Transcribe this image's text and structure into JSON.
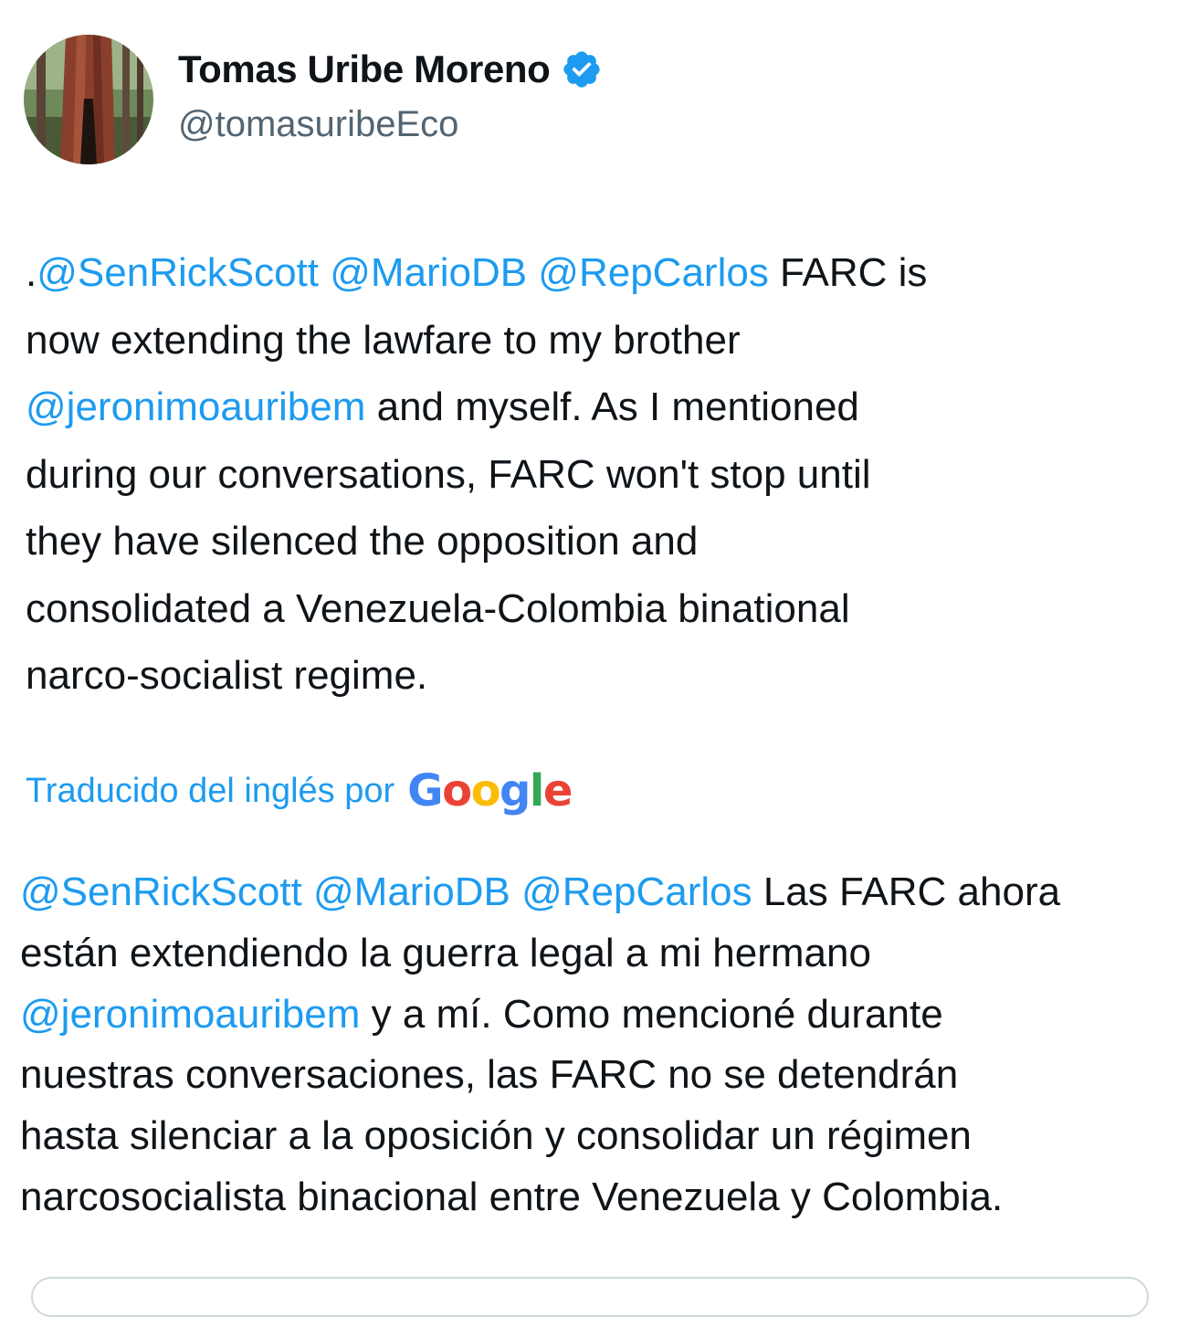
{
  "author": {
    "name": "Tomas Uribe Moreno",
    "handle": "@tomasuribeEco",
    "avatar_icon": "redwood-tree-avatar",
    "verified_icon": "verified-badge-icon",
    "verified_color": "#1d9bf0"
  },
  "tweet": {
    "lines": [
      [
        {
          "t": ".",
          "m": false
        },
        {
          "t": "@SenRickScott",
          "m": true
        },
        {
          "t": " ",
          "m": false
        },
        {
          "t": "@MarioDB",
          "m": true
        },
        {
          "t": " ",
          "m": false
        },
        {
          "t": "@RepCarlos",
          "m": true
        },
        {
          "t": " FARC is",
          "m": false
        }
      ],
      [
        {
          "t": "now extending the lawfare to my brother",
          "m": false
        }
      ],
      [
        {
          "t": "@jeronimoauribem",
          "m": true
        },
        {
          "t": " and myself. As I mentioned",
          "m": false
        }
      ],
      [
        {
          "t": "during our conversations, FARC won't stop until",
          "m": false
        }
      ],
      [
        {
          "t": "they have silenced the opposition and",
          "m": false
        }
      ],
      [
        {
          "t": "consolidated a Venezuela-Colombia binational",
          "m": false
        }
      ],
      [
        {
          "t": "narco-socialist regime.",
          "m": false
        }
      ]
    ]
  },
  "translation_note": {
    "label": "Traducido del inglés por",
    "logo": [
      {
        "t": "G",
        "c": "#4285f4"
      },
      {
        "t": "o",
        "c": "#ea4335"
      },
      {
        "t": "o",
        "c": "#fbbc05"
      },
      {
        "t": "g",
        "c": "#4285f4"
      },
      {
        "t": "l",
        "c": "#34a853"
      },
      {
        "t": "e",
        "c": "#ea4335"
      }
    ]
  },
  "translation": {
    "lines": [
      [
        {
          "t": "@SenRickScott",
          "m": true
        },
        {
          "t": " ",
          "m": false
        },
        {
          "t": "@MarioDB",
          "m": true
        },
        {
          "t": " ",
          "m": false
        },
        {
          "t": "@RepCarlos",
          "m": true
        },
        {
          "t": " Las FARC ahora",
          "m": false
        }
      ],
      [
        {
          "t": "están extendiendo la guerra legal a mi hermano",
          "m": false
        }
      ],
      [
        {
          "t": "@jeronimoauribem",
          "m": true
        },
        {
          "t": " y a mí. Como mencioné durante",
          "m": false
        }
      ],
      [
        {
          "t": "nuestras conversaciones, las FARC no se detendrán",
          "m": false
        }
      ],
      [
        {
          "t": "hasta silenciar a la oposición y consolidar un régimen",
          "m": false
        }
      ],
      [
        {
          "t": "narcosocialista binacional entre Venezuela y Colombia.",
          "m": false
        }
      ]
    ]
  },
  "colors": {
    "mention": "#1d9bf0",
    "text": "#0f1419",
    "secondary": "#536471"
  }
}
